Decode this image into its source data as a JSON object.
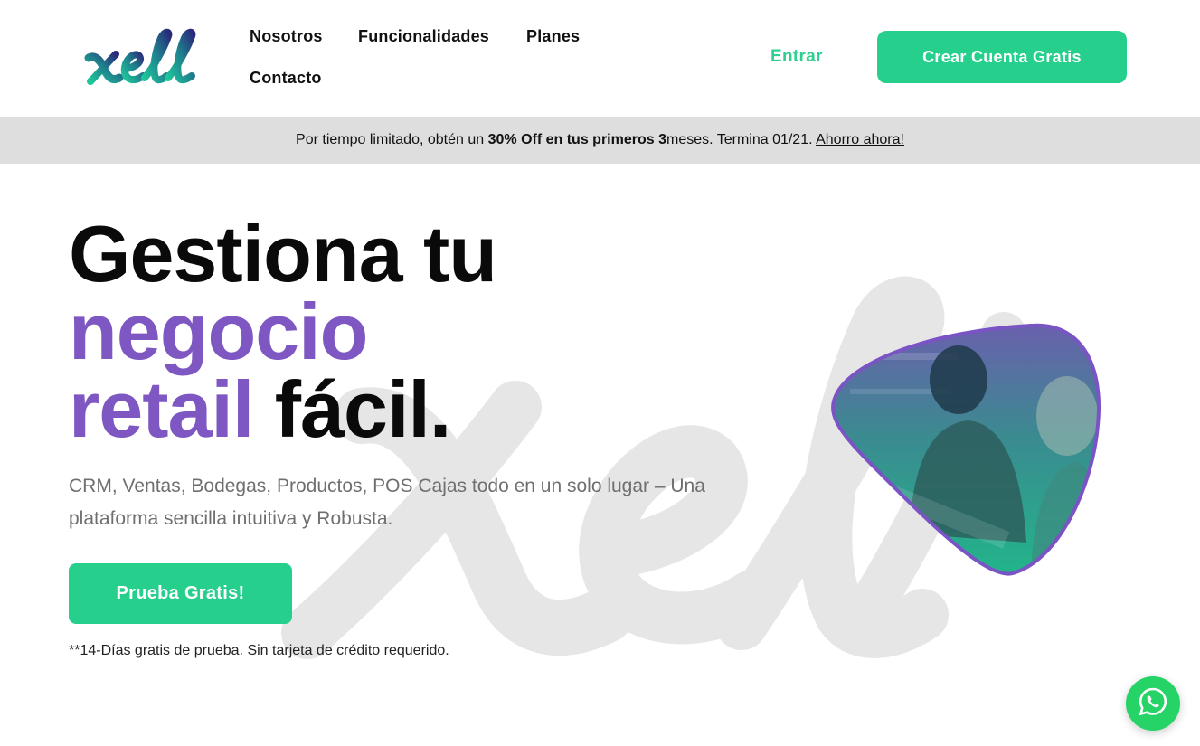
{
  "brand": {
    "logo_text": "xell",
    "accent": "#27cf8d",
    "purple": "#7e57c2"
  },
  "nav": {
    "items": [
      {
        "label": "Nosotros"
      },
      {
        "label": "Funcionalidades"
      },
      {
        "label": "Planes"
      },
      {
        "label": "Contacto"
      }
    ],
    "login_label": "Entrar",
    "signup_label": "Crear Cuenta Gratis"
  },
  "promo": {
    "prefix": "Por tiempo limitado, obtén un ",
    "highlight": "30% Off en tus primeros 3",
    "suffix": "meses. Termina 01/21. ",
    "link": "Ahorro ahora!"
  },
  "hero": {
    "title_line1": "Gestiona tu",
    "title_line2": "negocio",
    "title_line3_purple": "retail",
    "title_line3_black": "fácil.",
    "subtitle": "CRM, Ventas, Bodegas, Productos, POS Cajas todo en un solo lugar – Una plataforma sencilla intuitiva y Robusta.",
    "cta_label": "Prueba Gratis!",
    "disclaimer": "**14-Días gratis de prueba. Sin tarjeta de crédito requerido."
  },
  "floating": {
    "icon": "whatsapp-icon",
    "color": "#25d366"
  }
}
